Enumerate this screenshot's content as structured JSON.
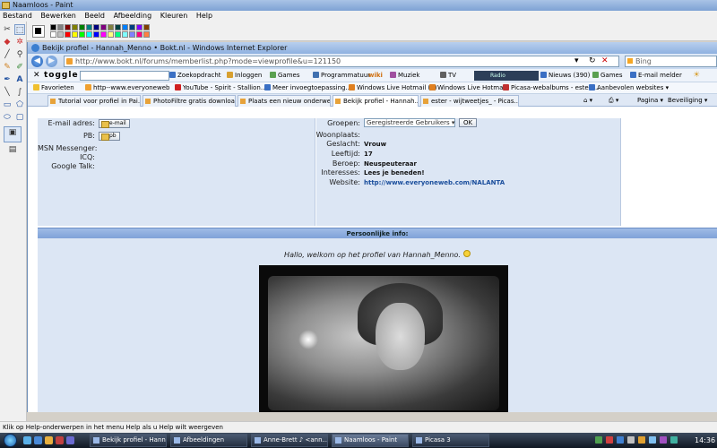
{
  "paint": {
    "title": "Naamloos - Paint",
    "menu": [
      "Bestand",
      "Bewerken",
      "Beeld",
      "Afbeelding",
      "Kleuren",
      "Help"
    ],
    "statusbar": "Klik op Help-onderwerpen in het menu Help als u Help wilt weergeven",
    "palette": [
      "#000000",
      "#808080",
      "#800000",
      "#808000",
      "#008000",
      "#008080",
      "#000080",
      "#800080",
      "#808040",
      "#004040",
      "#0080ff",
      "#004080",
      "#8000ff",
      "#804000",
      "#ffffff",
      "#c0c0c0",
      "#ff0000",
      "#ffff00",
      "#00ff00",
      "#00ffff",
      "#0000ff",
      "#ff00ff",
      "#ffff80",
      "#00ff80",
      "#80ffff",
      "#8080ff",
      "#ff0080",
      "#ff8040"
    ]
  },
  "ie": {
    "title": "Bekijk profiel - Hannah_Menno • Bokt.nl - Windows Internet Explorer",
    "url": "http://www.bokt.nl/forums/memberlist.php?mode=viewprofile&u=121150",
    "search_placeholder": "Bing",
    "toolbar": {
      "brand": "toggle",
      "items": [
        "Zoekopdracht",
        "Inloggen",
        "Games",
        "Programmatuur",
        "wiki",
        "Muziek",
        "TV",
        "Radio",
        "Nieuws (390)",
        "Games",
        "E-mail melder"
      ]
    },
    "favorites": {
      "label": "Favorieten",
      "items": [
        "http--www.everyoneweb",
        "YouTube - Spirit - Stallion...",
        "Meer invoegtoepassing...",
        "Windows Live Hotmail (2)",
        "Windows Live Hotmail",
        "Picasa-webalbums - ester ...",
        "Aanbevolen websites"
      ]
    },
    "tabs": [
      "Tutorial voor profiel in Pai...",
      "PhotoFiltre gratis downloa...",
      "Plaats een nieuw onderwer...",
      "Bekijk profiel - Hannah...",
      "ester - wijtweetjes_ - Picas..."
    ],
    "active_tab": 3,
    "commands": [
      "Pagina",
      "Beveiliging"
    ]
  },
  "profile": {
    "contact": {
      "email_label": "E-mail adres:",
      "email_button": "e-mail",
      "pb_label": "PB:",
      "pb_button": "pb",
      "msn_label": "MSN Messenger:",
      "icq_label": "ICQ:",
      "gtalk_label": "Google Talk:"
    },
    "info": {
      "groups_label": "Groepen:",
      "groups_value": "Geregistreerde Gebruikers",
      "groups_ok": "OK",
      "woonplaats_label": "Woonplaats:",
      "geslacht_label": "Geslacht:",
      "geslacht_value": "Vrouw",
      "leeftijd_label": "Leeftijd:",
      "leeftijd_value": "17",
      "beroep_label": "Beroep:",
      "beroep_value": "Neuspeuteraar",
      "interesses_label": "Interesses:",
      "interesses_value": "Lees je beneden!",
      "website_label": "Website:",
      "website_value": "http://www.everyoneweb.com/NALANTA"
    },
    "personal": {
      "header": "Persoonlijke info:",
      "welcome": "Hallo, welkom op het profiel van Hannah_Menno."
    }
  },
  "taskbar": {
    "tasks": [
      "Bekijk profiel - Hann...",
      "Afbeeldingen",
      "Anne-Brett ♪ <ann...",
      "Naamloos - Paint",
      "Picasa 3"
    ],
    "active_task": 3,
    "clock": "14:36"
  }
}
